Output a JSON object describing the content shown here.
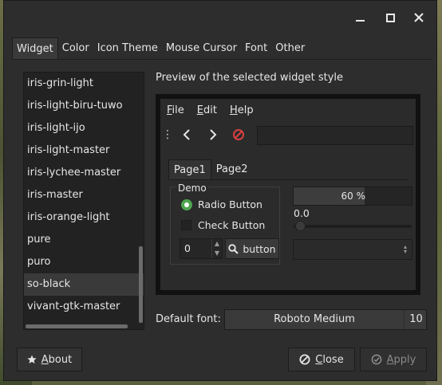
{
  "window": {
    "title_buttons": {
      "minimize_icon": "minimize-icon",
      "maximize_icon": "maximize-icon",
      "close_icon": "close-icon"
    }
  },
  "tabs": [
    "Widget",
    "Color",
    "Icon Theme",
    "Mouse Cursor",
    "Font",
    "Other"
  ],
  "active_tab": "Widget",
  "themes": [
    "iris-grin-light",
    "iris-light-biru-tuwo",
    "iris-light-ijo",
    "iris-light-master",
    "iris-lychee-master",
    "iris-master",
    "iris-orange-light",
    "pure",
    "puro",
    "so-black",
    "vivant-gtk-master"
  ],
  "selected_theme": "so-black",
  "preview": {
    "label": "Preview of the selected widget style",
    "menu": [
      {
        "mnemonic": "F",
        "rest": "ile"
      },
      {
        "mnemonic": "E",
        "rest": "dit"
      },
      {
        "mnemonic": "H",
        "rest": "elp"
      }
    ],
    "toolbar": {
      "grip": "⋮"
    },
    "tabs": [
      "Page1",
      "Page2"
    ],
    "demo_title": "Demo",
    "radio_label": "Radio Button",
    "check_label": "Check Button",
    "spin_value": "0",
    "button_label": "button",
    "progress_text": "60 %",
    "progress_fraction": 0.6,
    "scale_value": "0.0"
  },
  "font": {
    "label": "Default font:",
    "name": "Roboto Medium",
    "size": "10"
  },
  "buttons": {
    "about": {
      "mnemonic": "A",
      "rest": "bout"
    },
    "close": {
      "mnemonic": "C",
      "rest": "lose"
    },
    "apply": {
      "mnemonic": "A",
      "rest": "pply"
    }
  },
  "colors": {
    "window_bg": "#2d2d2d",
    "radio_green": "#4ea64e",
    "stop_red": "#d94040"
  }
}
